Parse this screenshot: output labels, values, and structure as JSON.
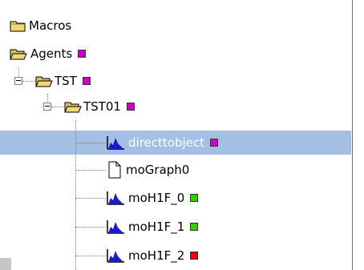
{
  "tree": {
    "nodes": [
      {
        "label": "Macros",
        "icon": "folder-icon"
      },
      {
        "label": "Agents",
        "icon": "folder-open-icon",
        "badge_color": "#cc00cc"
      },
      {
        "label": "TST",
        "icon": "folder-open-icon",
        "badge_color": "#cc00cc",
        "expanded": true
      },
      {
        "label": "TST01",
        "icon": "folder-open-icon",
        "badge_color": "#cc00cc",
        "expanded": true
      },
      {
        "label": "directtobject",
        "icon": "histogram-icon",
        "badge_color": "#cc00cc",
        "selected": true
      },
      {
        "label": "moGraph0",
        "icon": "document-icon"
      },
      {
        "label": "moH1F_0",
        "icon": "histogram-icon",
        "badge_color": "#33cc00"
      },
      {
        "label": "moH1F_1",
        "icon": "histogram-icon",
        "badge_color": "#33cc00"
      },
      {
        "label": "moH1F_2",
        "icon": "histogram-icon",
        "badge_color": "#ee0000"
      }
    ]
  },
  "colors": {
    "selection": "#a3bfe3",
    "folder": "#f0d878",
    "histogram": "#1a1acc"
  }
}
